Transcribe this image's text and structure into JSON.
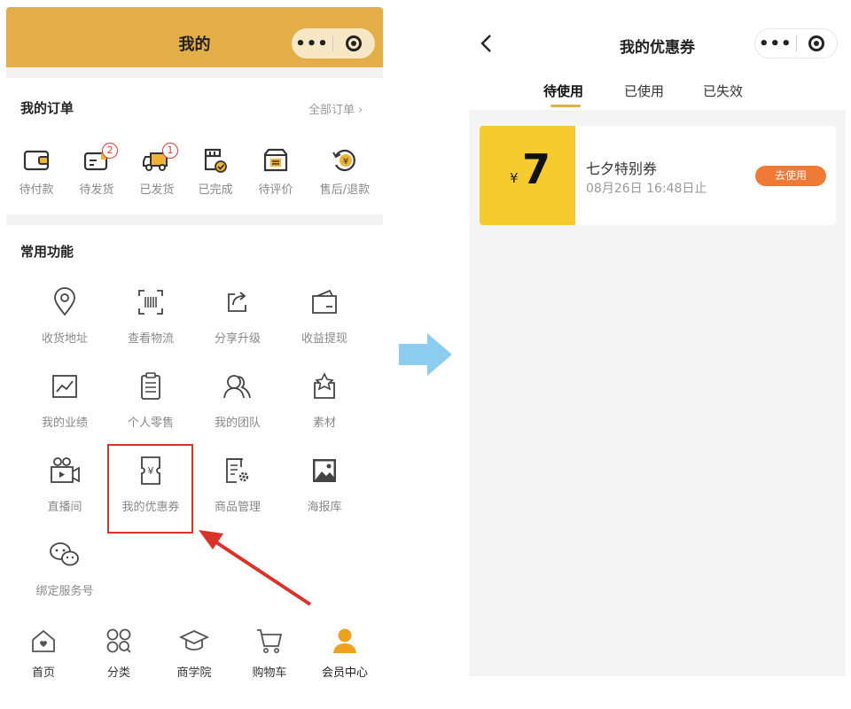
{
  "left": {
    "header": {
      "title": "我的"
    },
    "orders": {
      "title": "我的订单",
      "all_link": "全部订单 ›",
      "items": [
        {
          "label": "待付款",
          "icon": "wallet-icon",
          "badge": ""
        },
        {
          "label": "待发货",
          "icon": "package-icon",
          "badge": "2"
        },
        {
          "label": "已发货",
          "icon": "truck-icon",
          "badge": "1"
        },
        {
          "label": "已完成",
          "icon": "completed-icon",
          "badge": ""
        },
        {
          "label": "待评价",
          "icon": "review-box-icon",
          "badge": ""
        },
        {
          "label": "售后/退款",
          "icon": "refund-icon",
          "badge": ""
        }
      ]
    },
    "functions": {
      "title": "常用功能",
      "items": [
        {
          "label": "收货地址",
          "icon": "location-pin-icon"
        },
        {
          "label": "查看物流",
          "icon": "barcode-scan-icon"
        },
        {
          "label": "分享升级",
          "icon": "share-icon"
        },
        {
          "label": "收益提现",
          "icon": "withdraw-wallet-icon"
        },
        {
          "label": "我的业绩",
          "icon": "chart-line-icon"
        },
        {
          "label": "个人零售",
          "icon": "clipboard-icon"
        },
        {
          "label": "我的团队",
          "icon": "team-icon"
        },
        {
          "label": "素材",
          "icon": "material-star-icon"
        },
        {
          "label": "直播间",
          "icon": "video-camera-icon"
        },
        {
          "label": "我的优惠券",
          "icon": "coupon-icon"
        },
        {
          "label": "商品管理",
          "icon": "goods-settings-icon"
        },
        {
          "label": "海报库",
          "icon": "poster-image-icon"
        },
        {
          "label": "绑定服务号",
          "icon": "wechat-icon"
        }
      ]
    },
    "bottom_nav": [
      {
        "label": "首页",
        "icon": "home-icon",
        "active": false
      },
      {
        "label": "分类",
        "icon": "category-icon",
        "active": false
      },
      {
        "label": "商学院",
        "icon": "graduation-cap-icon",
        "active": false
      },
      {
        "label": "购物车",
        "icon": "cart-icon",
        "active": false
      },
      {
        "label": "会员中心",
        "icon": "user-icon",
        "active": true
      }
    ]
  },
  "right": {
    "header": {
      "title": "我的优惠券"
    },
    "tabs": [
      "待使用",
      "已使用",
      "已失效"
    ],
    "coupon": {
      "currency": "¥",
      "amount": "7",
      "name": "七夕特别券",
      "expiry": "08月26日 16:48日止",
      "button": "去使用"
    }
  },
  "colors": {
    "header_gold": "#E3AE48",
    "coupon_yellow": "#F6CB2F",
    "button_orange": "#EE7A36",
    "highlight_red": "#d9342b",
    "arrow_blue": "#8CCDEF"
  }
}
